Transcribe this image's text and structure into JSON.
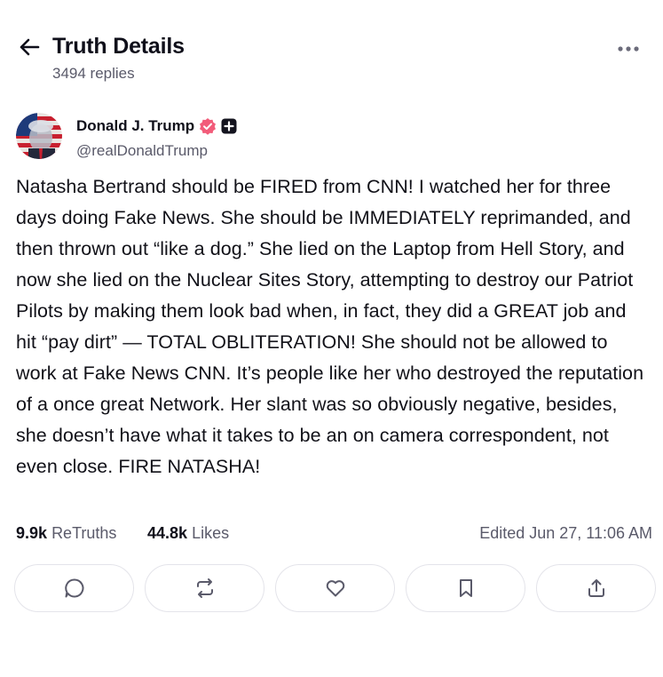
{
  "header": {
    "title": "Truth Details",
    "replies": "3494 replies",
    "back_icon": "arrow-left-icon",
    "more_icon": "more-horizontal-icon"
  },
  "author": {
    "name": "Donald J. Trump",
    "handle": "@realDonaldTrump",
    "verified_color": "#f25c7a",
    "badge_icon": "plus-badge-icon"
  },
  "post": {
    "text": "Natasha Bertrand should be FIRED from CNN! I watched her for three days doing Fake News. She should be IMMEDIATELY reprimanded, and then thrown out “like a dog.” She lied on the Laptop from Hell Story, and now she lied on the Nuclear Sites Story, attempting to destroy our Patriot Pilots by making them look bad when, in fact, they did a GREAT job and hit “pay dirt” — TOTAL OBLITERATION! She should not be allowed to work at Fake News CNN. It’s people like her who destroyed the reputation of a once great Network. Her slant was so obviously negative, besides, she doesn’t have what it takes to be an on camera correspondent, not even close. FIRE NATASHA!"
  },
  "stats": {
    "retruths_count": "9.9k",
    "retruths_label": "ReTruths",
    "likes_count": "44.8k",
    "likes_label": "Likes",
    "edited": "Edited Jun 27, 11:06 AM"
  },
  "actions": [
    {
      "name": "reply",
      "icon": "comment-icon"
    },
    {
      "name": "retruth",
      "icon": "repost-icon"
    },
    {
      "name": "like",
      "icon": "heart-icon"
    },
    {
      "name": "bookmark",
      "icon": "bookmark-icon"
    },
    {
      "name": "share",
      "icon": "share-icon"
    }
  ],
  "colors": {
    "text": "#0f0f1a",
    "muted": "#5a5a6a",
    "border": "#e4e4ea",
    "icon": "#5a5a6a"
  }
}
